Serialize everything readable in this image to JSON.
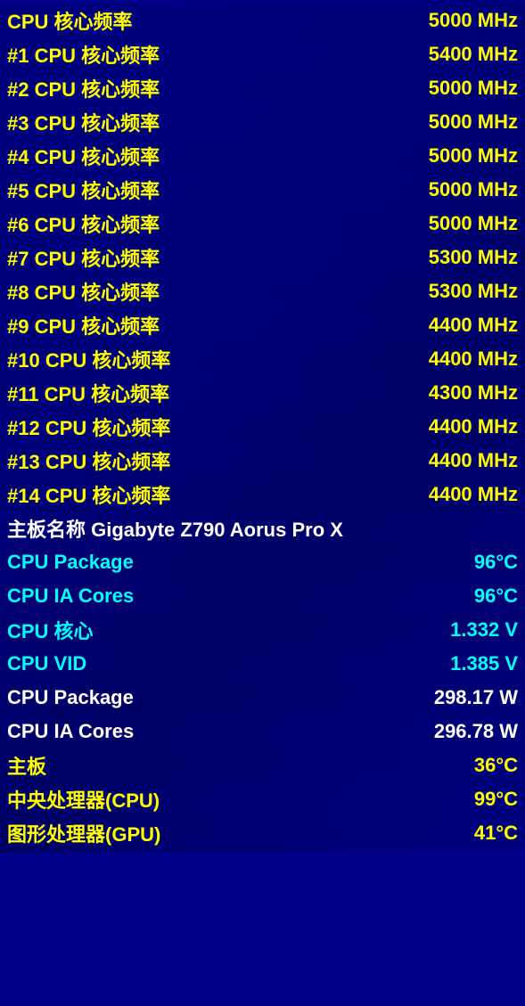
{
  "rows": [
    {
      "label": "CPU 核心频率",
      "value": "5000 MHz",
      "labelColor": "yellow",
      "valueColor": "yellow"
    },
    {
      "label": "#1 CPU 核心频率",
      "value": "5400 MHz",
      "labelColor": "yellow",
      "valueColor": "yellow"
    },
    {
      "label": "#2 CPU 核心频率",
      "value": "5000 MHz",
      "labelColor": "yellow",
      "valueColor": "yellow"
    },
    {
      "label": "#3 CPU 核心频率",
      "value": "5000 MHz",
      "labelColor": "yellow",
      "valueColor": "yellow"
    },
    {
      "label": "#4 CPU 核心频率",
      "value": "5000 MHz",
      "labelColor": "yellow",
      "valueColor": "yellow"
    },
    {
      "label": "#5 CPU 核心频率",
      "value": "5000 MHz",
      "labelColor": "yellow",
      "valueColor": "yellow"
    },
    {
      "label": "#6 CPU 核心频率",
      "value": "5000 MHz",
      "labelColor": "yellow",
      "valueColor": "yellow"
    },
    {
      "label": "#7 CPU 核心频率",
      "value": "5300 MHz",
      "labelColor": "yellow",
      "valueColor": "yellow"
    },
    {
      "label": "#8 CPU 核心频率",
      "value": "5300 MHz",
      "labelColor": "yellow",
      "valueColor": "yellow"
    },
    {
      "label": "#9 CPU 核心频率",
      "value": "4400 MHz",
      "labelColor": "yellow",
      "valueColor": "yellow"
    },
    {
      "label": "#10 CPU 核心频率",
      "value": "4400 MHz",
      "labelColor": "yellow",
      "valueColor": "yellow"
    },
    {
      "label": "#11 CPU 核心频率",
      "value": "4300 MHz",
      "labelColor": "yellow",
      "valueColor": "yellow"
    },
    {
      "label": "#12 CPU 核心频率",
      "value": "4400 MHz",
      "labelColor": "yellow",
      "valueColor": "yellow"
    },
    {
      "label": "#13 CPU 核心频率",
      "value": "4400 MHz",
      "labelColor": "yellow",
      "valueColor": "yellow"
    },
    {
      "label": "#14 CPU 核心频率",
      "value": "4400 MHz",
      "labelColor": "yellow",
      "valueColor": "yellow"
    },
    {
      "label": "主板名称   Gigabyte Z790 Aorus Pro X",
      "value": "",
      "labelColor": "white",
      "valueColor": "white"
    },
    {
      "label": "CPU Package",
      "value": "96°C",
      "labelColor": "cyan",
      "valueColor": "cyan"
    },
    {
      "label": "CPU IA Cores",
      "value": "96°C",
      "labelColor": "cyan",
      "valueColor": "cyan"
    },
    {
      "label": "CPU 核心",
      "value": "1.332 V",
      "labelColor": "cyan",
      "valueColor": "cyan"
    },
    {
      "label": "CPU VID",
      "value": "1.385 V",
      "labelColor": "cyan",
      "valueColor": "cyan"
    },
    {
      "label": "CPU Package",
      "value": "298.17 W",
      "labelColor": "white",
      "valueColor": "white"
    },
    {
      "label": "CPU IA Cores",
      "value": "296.78 W",
      "labelColor": "white",
      "valueColor": "white"
    },
    {
      "label": "主板",
      "value": "36°C",
      "labelColor": "yellow",
      "valueColor": "yellow"
    },
    {
      "label": "中央处理器(CPU)",
      "value": "99°C",
      "labelColor": "yellow",
      "valueColor": "yellow"
    },
    {
      "label": "图形处理器(GPU)",
      "value": "41°C",
      "labelColor": "yellow",
      "valueColor": "yellow"
    }
  ]
}
